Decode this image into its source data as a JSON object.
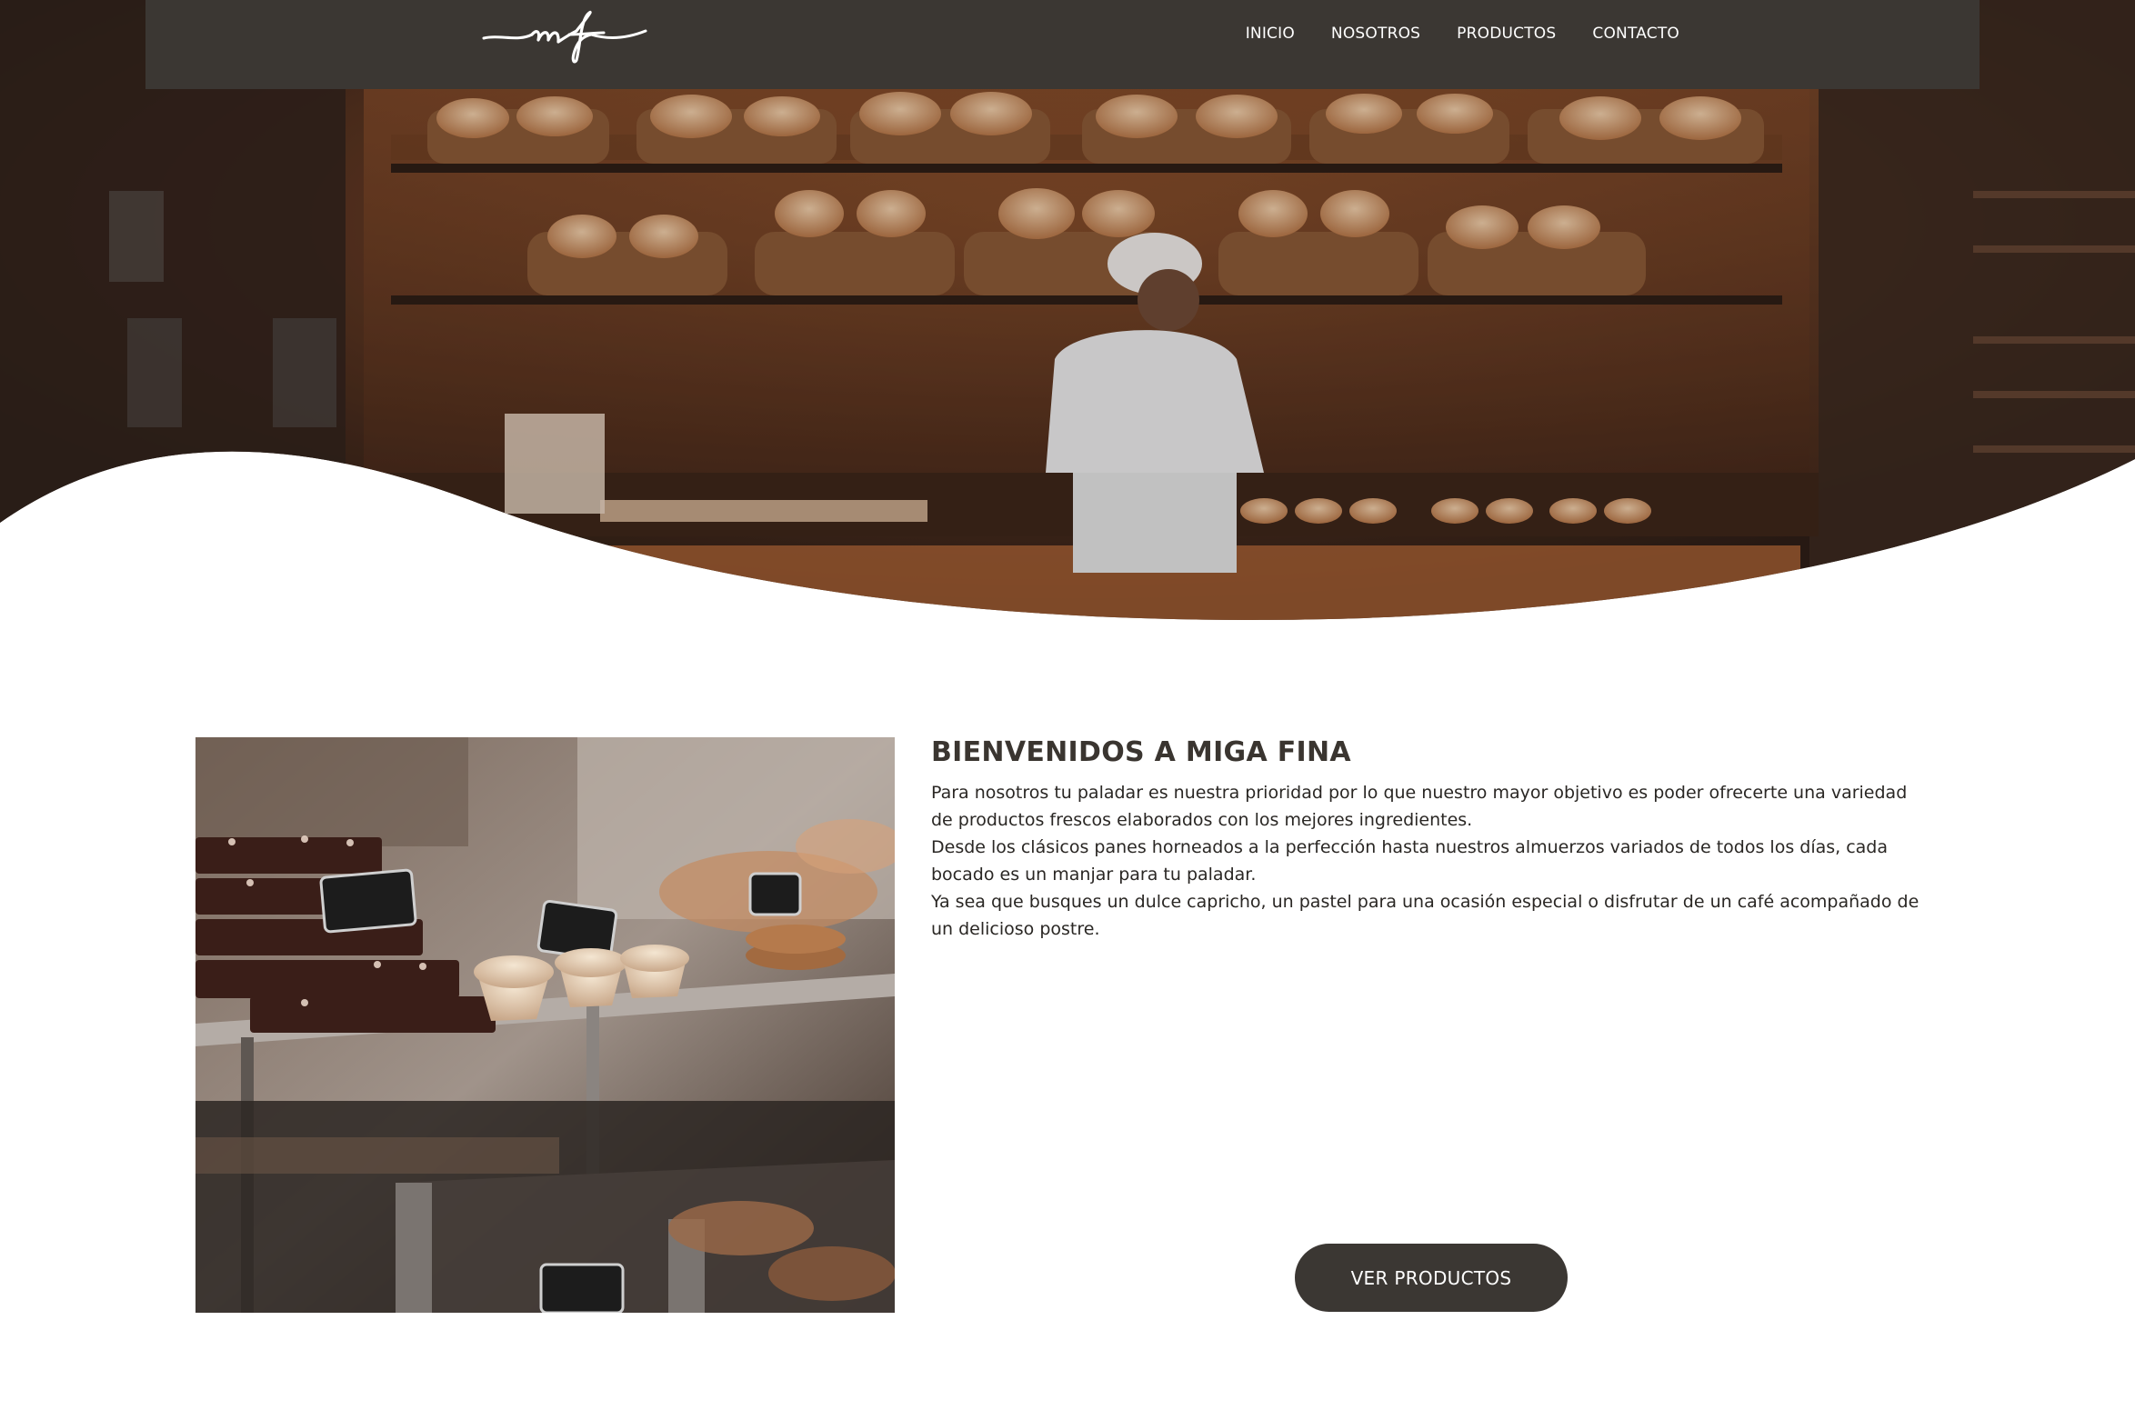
{
  "brand": {
    "logo_text": "mf"
  },
  "nav": {
    "items": [
      {
        "label": "INICIO"
      },
      {
        "label": "NOSOTROS"
      },
      {
        "label": "PRODUCTOS"
      },
      {
        "label": "CONTACTO"
      }
    ]
  },
  "welcome": {
    "title": "BIENVENIDOS A MIGA FINA",
    "paragraphs": [
      "Para nosotros tu paladar es nuestra prioridad por lo que nuestro mayor objetivo es poder ofrecerte una variedad de productos frescos elaborados con los mejores ingredientes.",
      "Desde los clásicos panes horneados a la perfección hasta nuestros almuerzos variados de todos los días, cada bocado es un manjar para tu paladar.",
      "Ya sea que busques un dulce capricho, un pastel para una ocasión especial o disfrutar de un café acompañado de un delicioso postre."
    ],
    "cta_label": "VER PRODUCTOS"
  },
  "colors": {
    "navbar": "#3b3733",
    "button": "#3b3733",
    "heading": "#3a3530",
    "hero_warm": "#b86a38"
  }
}
